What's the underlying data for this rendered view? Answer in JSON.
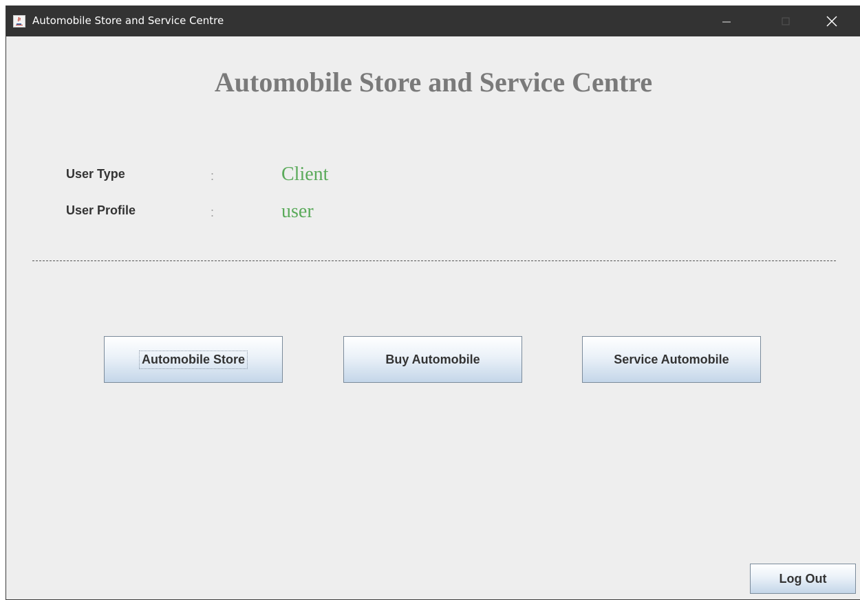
{
  "window": {
    "title": "Automobile Store and Service Centre",
    "app_icon": "java-cup-icon",
    "controls": {
      "minimize_icon": "minimize-icon",
      "maximize_icon": "maximize-icon",
      "close_icon": "close-icon"
    }
  },
  "main": {
    "heading": "Automobile Store and Service Centre",
    "fields": {
      "user_type": {
        "label": "User Type",
        "colon": ":",
        "value": "Client"
      },
      "user_profile": {
        "label": "User Profile",
        "colon": ":",
        "value": "user"
      }
    },
    "buttons": {
      "automobile_store": "Automobile Store",
      "buy_automobile": "Buy Automobile",
      "service_automobile": "Service Automobile",
      "log_out": "Log Out"
    }
  },
  "colors": {
    "titlebar": "#333333",
    "background": "#eeeeee",
    "heading": "#7a7a7a",
    "value_green": "#5aaa5a",
    "button_gradient_bottom": "#c4d6e9"
  }
}
